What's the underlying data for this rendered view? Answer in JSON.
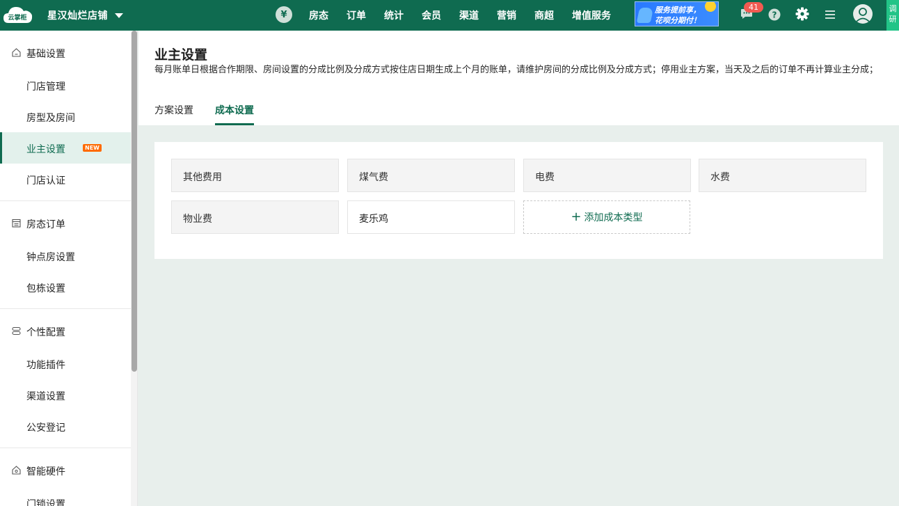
{
  "topbar": {
    "logo_text": "云掌柜",
    "store_name": "星汉灿烂店铺",
    "yen_symbol": "¥",
    "nav": [
      "房态",
      "订单",
      "统计",
      "会员",
      "渠道",
      "营销",
      "商超",
      "增值服务"
    ],
    "banner_line1": "服务提前享，",
    "banner_line2": "花呗分期付！",
    "message_count": "41",
    "tiaoyan_top": "调",
    "tiaoyan_bottom": "研"
  },
  "sidebar": {
    "groups": [
      {
        "label": "基础设置",
        "icon": "home-icon"
      },
      {
        "label": "房态订单",
        "icon": "calendar-icon"
      },
      {
        "label": "个性配置",
        "icon": "config-icon"
      },
      {
        "label": "智能硬件",
        "icon": "home-icon"
      }
    ],
    "items": [
      "门店管理",
      "房型及房间",
      "业主设置",
      "门店认证",
      "钟点房设置",
      "包栋设置",
      "功能插件",
      "渠道设置",
      "公安登记",
      "门锁设置"
    ],
    "new_tag": "NEW",
    "active_item": "业主设置"
  },
  "page": {
    "title": "业主设置",
    "description": "每月账单日根据合作期限、房间设置的分成比例及分成方式按住店日期生成上个月的账单，请维护房间的分成比例及分成方式；停用业主方案，当天及之后的订单不再计算业主分成；",
    "tabs": [
      "方案设置",
      "成本设置"
    ],
    "active_tab": "成本设置"
  },
  "costs": {
    "items": [
      "其他费用",
      "煤气费",
      "电费",
      "水费",
      "物业费",
      "麦乐鸡"
    ],
    "add_label": "添加成本类型",
    "add_icon": "+"
  },
  "colors": {
    "brand": "#0f6b50",
    "accent_new": "#ff6a00",
    "badge": "#f25a51",
    "tiaoyan": "#22c487"
  }
}
